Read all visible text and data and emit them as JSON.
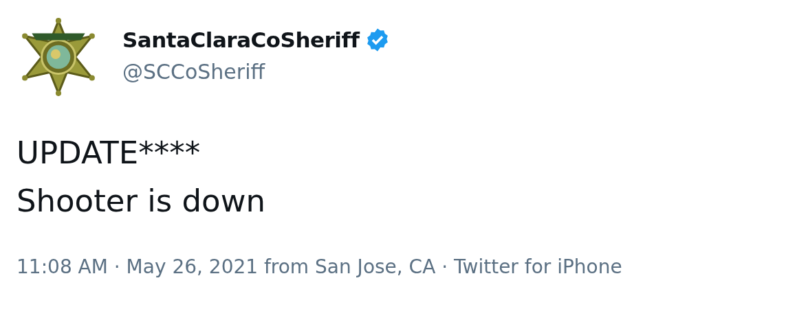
{
  "tweet": {
    "author": {
      "name": "SantaClaraCoSheriff",
      "verified": true,
      "handle": "@SCCoSheriff"
    },
    "text_lines": [
      "UPDATE****",
      "Shooter is down"
    ],
    "meta": "11:08 AM · May 26, 2021 from San Jose, CA · Twitter for iPhone"
  }
}
